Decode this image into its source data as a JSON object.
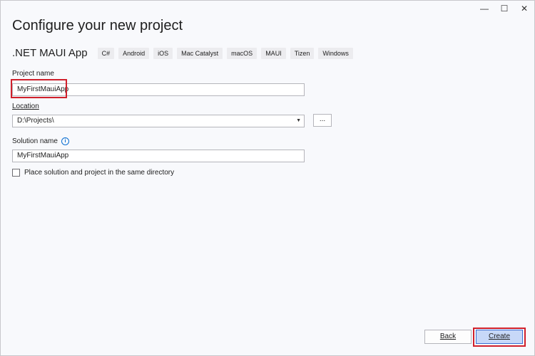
{
  "window": {
    "minimize_icon": "minimize-icon",
    "maximize_icon": "maximize-icon",
    "close_icon": "close-icon",
    "minimize_glyph": "—",
    "maximize_glyph": "☐",
    "close_glyph": "✕"
  },
  "header": {
    "title": "Configure your new project"
  },
  "template": {
    "name": ".NET MAUI App",
    "tags": [
      "C#",
      "Android",
      "iOS",
      "Mac Catalyst",
      "macOS",
      "MAUI",
      "Tizen",
      "Windows"
    ]
  },
  "form": {
    "project_name_label": "Project name",
    "project_name_value": "MyFirstMauiApp",
    "location_label": "Location",
    "location_value": "D:\\Projects\\",
    "browse_label": "...",
    "solution_name_label": "Solution name",
    "solution_name_value": "MyFirstMauiApp",
    "same_directory_label": "Place solution and project in the same directory",
    "same_directory_checked": false
  },
  "footer": {
    "back_label": "Back",
    "create_label": "Create"
  },
  "colors": {
    "highlight": "#d0202b",
    "primary_button": "#c7d8f8",
    "info_icon": "#0a6ed1"
  }
}
